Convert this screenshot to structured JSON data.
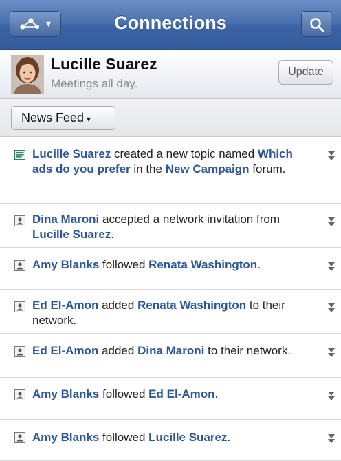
{
  "header": {
    "title": "Connections",
    "nav_icon": "network-icon",
    "search_icon": "search-icon"
  },
  "profile": {
    "name": "Lucille Suarez",
    "status": "Meetings all day.",
    "update_label": "Update"
  },
  "feed_selector": {
    "label": "News Feed",
    "caret": "▾"
  },
  "feed": [
    {
      "icon": "forum-topic-icon",
      "segments": [
        {
          "t": "Lucille Suarez",
          "link": true
        },
        {
          "t": " created a new topic named ",
          "link": false
        },
        {
          "t": "Which ads do you prefer",
          "link": true
        },
        {
          "t": " in the ",
          "link": false
        },
        {
          "t": "New Campaign",
          "link": true
        },
        {
          "t": " forum.",
          "link": false
        }
      ]
    },
    {
      "icon": "person-icon",
      "segments": [
        {
          "t": "Dina Maroni",
          "link": true
        },
        {
          "t": " accepted a network invitation from ",
          "link": false
        },
        {
          "t": "Lucille Suarez",
          "link": true
        },
        {
          "t": ".",
          "link": false
        }
      ]
    },
    {
      "icon": "person-icon",
      "segments": [
        {
          "t": "Amy Blanks",
          "link": true
        },
        {
          "t": " followed ",
          "link": false
        },
        {
          "t": "Renata Washington",
          "link": true
        },
        {
          "t": ".",
          "link": false
        }
      ]
    },
    {
      "icon": "person-icon",
      "segments": [
        {
          "t": "Ed El-Amon",
          "link": true
        },
        {
          "t": " added ",
          "link": false
        },
        {
          "t": "Renata Washington",
          "link": true
        },
        {
          "t": " to their network.",
          "link": false
        }
      ]
    },
    {
      "icon": "person-icon",
      "segments": [
        {
          "t": "Ed El-Amon",
          "link": true
        },
        {
          "t": " added ",
          "link": false
        },
        {
          "t": "Dina Maroni",
          "link": true
        },
        {
          "t": " to their network.",
          "link": false
        }
      ]
    },
    {
      "icon": "person-icon",
      "segments": [
        {
          "t": "Amy Blanks",
          "link": true
        },
        {
          "t": " followed ",
          "link": false
        },
        {
          "t": "Ed El-Amon",
          "link": true
        },
        {
          "t": ".",
          "link": false
        }
      ]
    },
    {
      "icon": "person-icon",
      "segments": [
        {
          "t": "Amy Blanks",
          "link": true
        },
        {
          "t": " followed ",
          "link": false
        },
        {
          "t": "Lucille Suarez",
          "link": true
        },
        {
          "t": ".",
          "link": false
        }
      ]
    }
  ],
  "colors": {
    "header_blue": "#4a70ad",
    "link_blue": "#2b579a"
  }
}
